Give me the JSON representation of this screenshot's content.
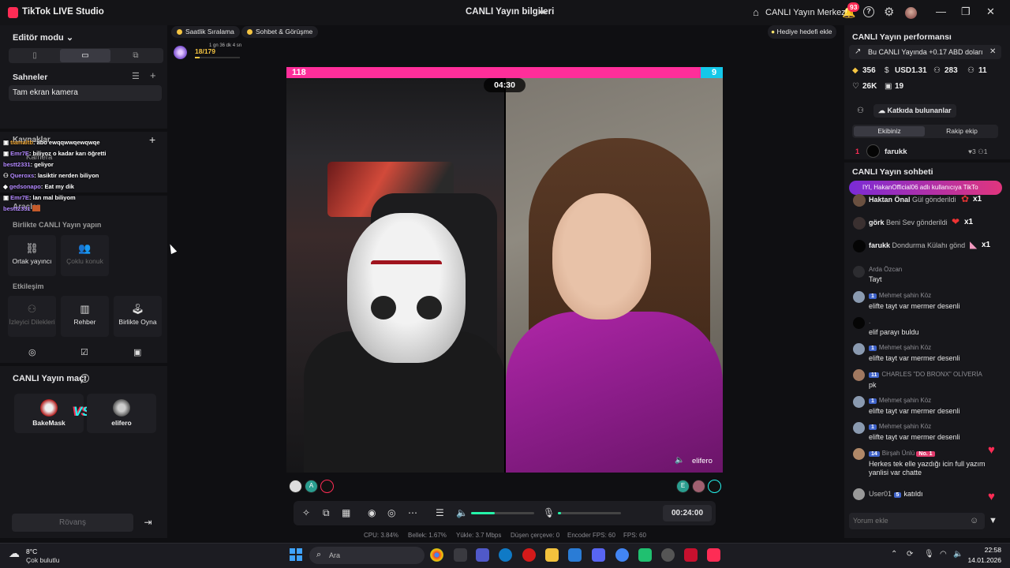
{
  "titlebar": {
    "app_name": "TikTok LIVE Studio",
    "center_title": "CANLI Yayın bilgileri",
    "live_center": "CANLI Yayın Merkezi",
    "notif_count": "93",
    "win_min": "—",
    "win_max": "❐",
    "win_close": "✕"
  },
  "left": {
    "editor_mode": "Editör modu ⌄",
    "scenes_label": "Sahneler",
    "scene_item": "Tam ekran kamera",
    "sources_label": "Kaynaklar",
    "source_camera": "Kamera",
    "tools_label": "Araçlar",
    "collab_label": "Birlikte CANLI Yayın yapın",
    "collab_tools": [
      {
        "label": "Ortak yayıncı",
        "icon": "link-icon"
      },
      {
        "label": "Çoklu konuk",
        "icon": "users-icon"
      }
    ],
    "interact_label": "Etkileşim",
    "interact_tools": [
      {
        "label": "İzleyici Dilekleri",
        "icon": "wish-icon"
      },
      {
        "label": "Rehber",
        "icon": "book-icon"
      },
      {
        "label": "Birlikte Oyna",
        "icon": "joystick-icon"
      }
    ],
    "match_title": "CANLI Yayın maçı",
    "match_left_name": "BakeMask",
    "match_right_name": "elifero",
    "vs": "VS",
    "rematch": "Rövanş"
  },
  "overlay_chat": [
    {
      "name": "tiamaltb",
      "text": ": abo ewqqwwqewqwqe"
    },
    {
      "name": "Emr7E",
      "text": ": biliyoz o kadar karı öğretti"
    },
    {
      "name": "bestt2331",
      "text": ": geliyor"
    },
    {
      "name": "Queroxs",
      "text": ": lasiktir nerden biliyon"
    },
    {
      "name": "gedsonapo",
      "text": ": Eat my dik"
    },
    {
      "name": "Emr7E",
      "text": ": lan mal biliyom"
    },
    {
      "name": "bestt2331",
      "text": ""
    }
  ],
  "top": {
    "chip_hourly": "Saatlik Sıralama",
    "chip_chat": "Sohbet & Görüşme",
    "goal_count": "18/179",
    "goal_time": "1 gn 36 dk 4 sn",
    "goal_progress": 0.1,
    "gift_goal": "Hediye hedefi ekle"
  },
  "battle": {
    "score_left": "118",
    "score_right": "9",
    "timer": "04:30",
    "right_name": "elifero"
  },
  "participants_left": [
    "3",
    "A",
    "1"
  ],
  "participants_right": [
    "E",
    "2",
    "3"
  ],
  "controls": {
    "duration": "00:24:00",
    "volume": 0.38,
    "mic": 0.05
  },
  "stats": {
    "cpu": "CPU:  3.84%",
    "memory": "Bellek:  1.67%",
    "upload": "Yükle:  3.7 Mbps",
    "dropped": "Düşen çerçeve:  0",
    "encoder_fps": "Encoder FPS:  60",
    "fps": "FPS:  60"
  },
  "right": {
    "perf_title": "CANLI Yayın performansı",
    "earnings": "Bu CANLI Yayında +0.17 ABD doları",
    "metrics": {
      "coins": "356",
      "usd": "USD1.31",
      "viewers": "283",
      "gifters": "11",
      "likes": "26K",
      "views": "19"
    },
    "contributors": "Katkıda bulunanlar",
    "tab_ours": "Ekibiniz",
    "tab_rival": "Rakip ekip",
    "rank": {
      "num": "1",
      "name": "farukk",
      "stats": "♥3  ⚇1"
    },
    "chat_title": "CANLI Yayın sohbeti",
    "banner": "IYI, HakanOfficial06 adlı kullanıcıya TikTo",
    "gifts": [
      {
        "name": "Haktan Önal",
        "action": "Gül gönderildi",
        "count": "x1"
      },
      {
        "name": "görk",
        "action": "Beni Sev gönderildi",
        "count": "x1"
      },
      {
        "name": "farukk",
        "action": "Dondurma Külahı gönd",
        "count": "x1"
      }
    ],
    "comments": [
      {
        "name": "Arda Özcan",
        "level": "",
        "msg": "Tayt"
      },
      {
        "name": "Mehmet şahin Köz",
        "level": "1",
        "msg": "elifte tayt var mermer desenli"
      },
      {
        "name": ".",
        "level": "",
        "msg": "elif parayı buldu"
      },
      {
        "name": "Mehmet şahin Köz",
        "level": "1",
        "msg": "elifte tayt var mermer desenli"
      },
      {
        "name": "CHARLES \"DO BRONX\" OLİVERİA",
        "level": "11",
        "msg": "pk"
      },
      {
        "name": "Mehmet şahin Köz",
        "level": "1",
        "msg": "elifte tayt var mermer desenli"
      },
      {
        "name": "Mehmet şahin Köz",
        "level": "1",
        "msg": "elifte tayt var mermer desenli"
      },
      {
        "name": "Birşah Ünlü",
        "level": "14",
        "badge": "No. 1",
        "msg": "Herkes tek elle yazdığı icin full yazım",
        "msg2": "yanlisi var chatte"
      }
    ],
    "join": {
      "name": "User01",
      "level": "5",
      "msg": "katıldı"
    },
    "comment_placeholder": "Yorum ekle"
  },
  "taskbar": {
    "weather_temp": "8°C",
    "weather_desc": "Çok bulutlu",
    "search": "Ara",
    "time": "22:58",
    "date": "14.01.2026"
  }
}
